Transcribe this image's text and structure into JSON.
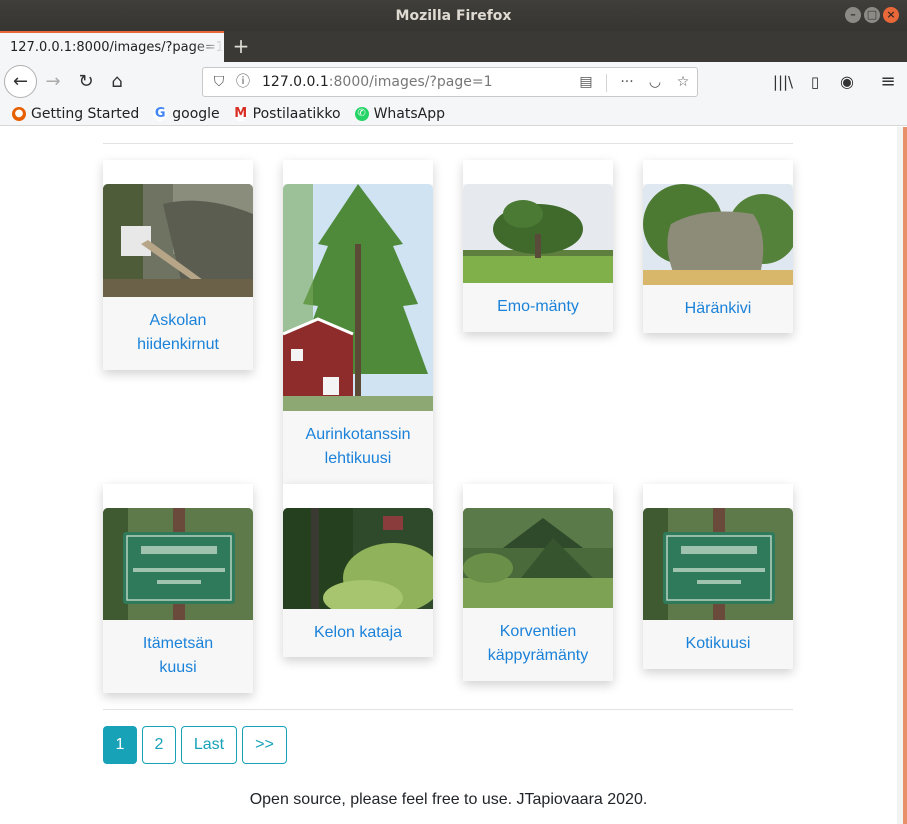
{
  "window": {
    "title": "Mozilla Firefox"
  },
  "tab": {
    "title": "127.0.0.1:8000/images/?page=1"
  },
  "urlbar": {
    "host": "127.0.0.1",
    "rest": ":8000/images/?page=1"
  },
  "bookmarks": [
    {
      "label": "Getting Started"
    },
    {
      "label": "google"
    },
    {
      "label": "Postilaatikko"
    },
    {
      "label": "WhatsApp"
    }
  ],
  "cards": [
    {
      "title_line1": "Askolan",
      "title_line2": "hiidenkirnut"
    },
    {
      "title_line1": "Aurinkotanssin",
      "title_line2": "lehtikuusi"
    },
    {
      "title_line1": "Emo-mänty",
      "title_line2": ""
    },
    {
      "title_line1": "Häränkivi",
      "title_line2": ""
    },
    {
      "title_line1": "Itämetsän",
      "title_line2": "kuusi"
    },
    {
      "title_line1": "Kelon kataja",
      "title_line2": ""
    },
    {
      "title_line1": "Korventien",
      "title_line2": "käppyrämänty"
    },
    {
      "title_line1": "Kotikuusi",
      "title_line2": ""
    }
  ],
  "pagination": {
    "page1": "1",
    "page2": "2",
    "last": "Last",
    "next": ">>"
  },
  "footer": {
    "text": "Open source, please feel free to use. JTapiovaara 2020."
  },
  "colors": {
    "accent": "#17a2b8",
    "link": "#1b82d9",
    "tab_highlight": "#e9683a"
  }
}
